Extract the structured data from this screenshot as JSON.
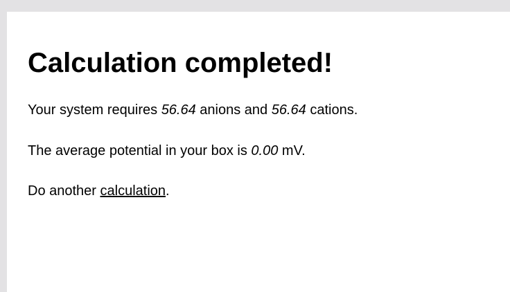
{
  "heading": "Calculation completed!",
  "result": {
    "prefix": "Your system requires ",
    "anions_value": "56.64",
    "middle": " anions and ",
    "cations_value": "56.64",
    "suffix": " cations."
  },
  "potential": {
    "prefix": "The average potential in your box is ",
    "value": "0.00",
    "suffix": " mV."
  },
  "another": {
    "prefix": "Do another ",
    "link_label": "calculation",
    "suffix": "."
  }
}
